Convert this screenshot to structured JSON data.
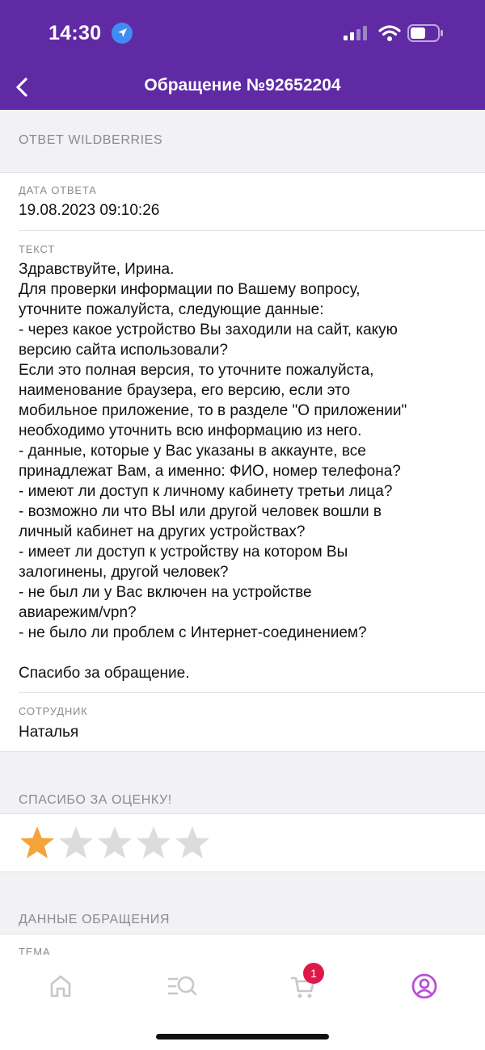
{
  "status_bar": {
    "time": "14:30"
  },
  "header": {
    "title": "Обращение №92652204"
  },
  "answer": {
    "section_title": "ОТВЕТ WILDBERRIES",
    "date_label": "ДАТА ОТВЕТА",
    "date_value": "19.08.2023 09:10:26",
    "text_label": "ТЕКСТ",
    "text_lines": [
      "Здравствуйте, Ирина.",
      "Для проверки информации по Вашему вопросу,",
      "уточните пожалуйста, следующие данные:",
      "- через какое устройство Вы заходили на сайт, какую",
      "версию сайта использовали?",
      "Если это полная версия, то уточните пожалуйста,",
      "наименование браузера, его версию, если это",
      "мобильное приложение, то в разделе \"О приложении\"",
      "необходимо уточнить всю информацию из него.",
      "- данные, которые у Вас указаны в аккаунте, все",
      "принадлежат Вам, а именно: ФИО, номер телефона?",
      "- имеют ли доступ к личному кабинету третьи лица?",
      "- возможно ли что ВЫ или другой человек вошли в",
      "личный кабинет на других устройствах?",
      "- имеет ли доступ к устройству на котором Вы",
      "залогинены, другой человек?",
      "- не был ли у Вас включен на устройстве",
      "авиарежим/vpn?",
      "- не было ли проблем с Интернет-соединением?",
      "",
      "Спасибо за обращение."
    ],
    "employee_label": "СОТРУДНИК",
    "employee_value": "Наталья"
  },
  "rating": {
    "section_title": "СПАСИБО ЗА ОЦЕНКУ!",
    "value": 1,
    "max": 5,
    "colors": {
      "filled": "#f4a43a",
      "empty": "#dcdcdf"
    }
  },
  "request_data": {
    "section_title": "ДАННЫЕ ОБРАЩЕНИЯ",
    "topic_label": "ТЕМА"
  },
  "tabbar": {
    "items": [
      {
        "name": "home-icon"
      },
      {
        "name": "catalog-search-icon"
      },
      {
        "name": "cart-icon",
        "badge": "1"
      },
      {
        "name": "profile-icon"
      }
    ],
    "colors": {
      "inactive": "#c6c6cc",
      "active": "#b94fd6"
    }
  },
  "colors": {
    "header_bg": "#5f2aa3",
    "badge": "#e0184a"
  }
}
